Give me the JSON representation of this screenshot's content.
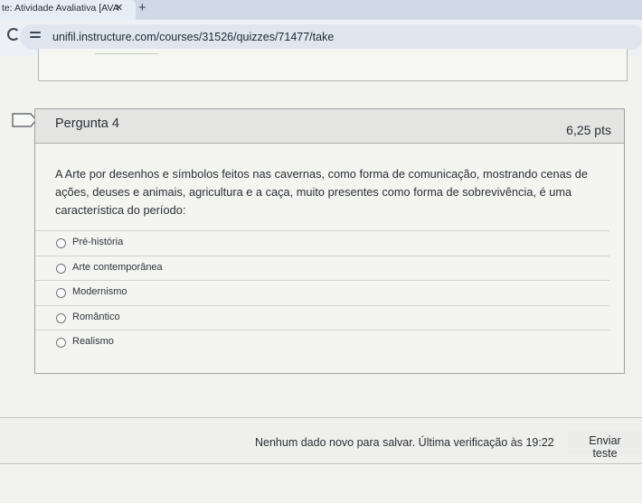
{
  "browser": {
    "tab_title": "te: Atividade Avaliativa [AVA",
    "tab_close": "✕",
    "new_tab": "+",
    "url": "unifil.instructure.com/courses/31526/quizzes/71477/take"
  },
  "question": {
    "title": "Pergunta 4",
    "points": "6,25 pts",
    "text": "A Arte por desenhos e símbolos feitos nas cavernas, como forma de comunicação, mostrando cenas de ações, deuses e animais, agricultura e a caça, muito presentes como forma de sobrevivência, é uma característica do período:",
    "answers": [
      "Pré-história",
      "Arte contemporânea",
      "Modernismo",
      "Romântico",
      "Realismo"
    ]
  },
  "footer": {
    "save_status": "Nenhum dado novo para salvar. Última verificação às 19:22",
    "submit_label": "Enviar teste"
  }
}
